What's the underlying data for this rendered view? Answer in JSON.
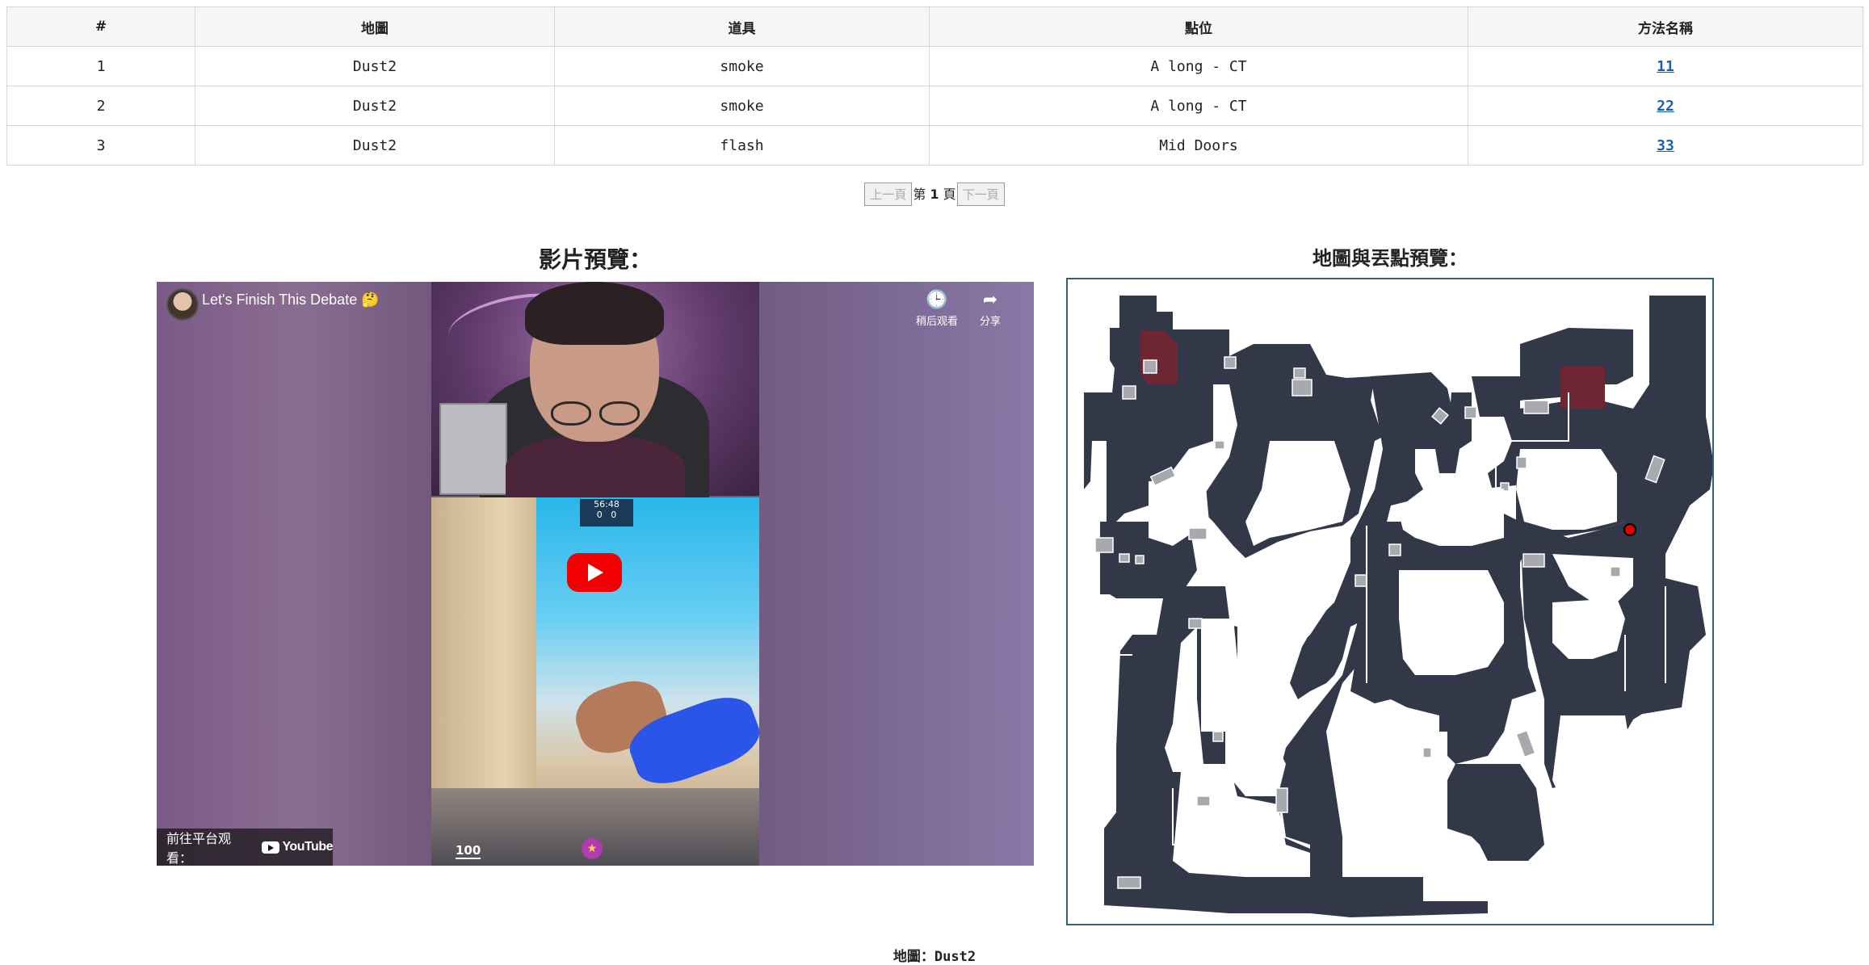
{
  "table": {
    "headers": [
      "#",
      "地圖",
      "道具",
      "點位",
      "方法名稱"
    ],
    "rows": [
      {
        "no": "1",
        "map": "Dust2",
        "utility": "smoke",
        "position": "A long - CT",
        "method": "11"
      },
      {
        "no": "2",
        "map": "Dust2",
        "utility": "smoke",
        "position": "A long - CT",
        "method": "22"
      },
      {
        "no": "3",
        "map": "Dust2",
        "utility": "flash",
        "position": "Mid Doors",
        "method": "33"
      }
    ]
  },
  "pagination": {
    "prev_label": "上一頁",
    "page_prefix": "第",
    "page_number": "1",
    "page_suffix": "頁",
    "next_label": "下一頁"
  },
  "video_section": {
    "heading": "影片預覽：",
    "title": "Let's Finish This Debate 🤔",
    "watch_later_label": "稍后观看",
    "share_label": "分享",
    "watch_on_label": "前往平台观看：",
    "platform_label": "YouTube",
    "hud_score_time": "56:48",
    "hud_score_left": "0",
    "hud_score_right": "0",
    "hud_health": "100"
  },
  "map_section": {
    "heading": "地圖與丟點預覽：",
    "marker_color": "#e00000",
    "map_fill": "#333849",
    "site_color": "#6d2632"
  },
  "caption": {
    "label": "地圖：",
    "value": "Dust2"
  }
}
